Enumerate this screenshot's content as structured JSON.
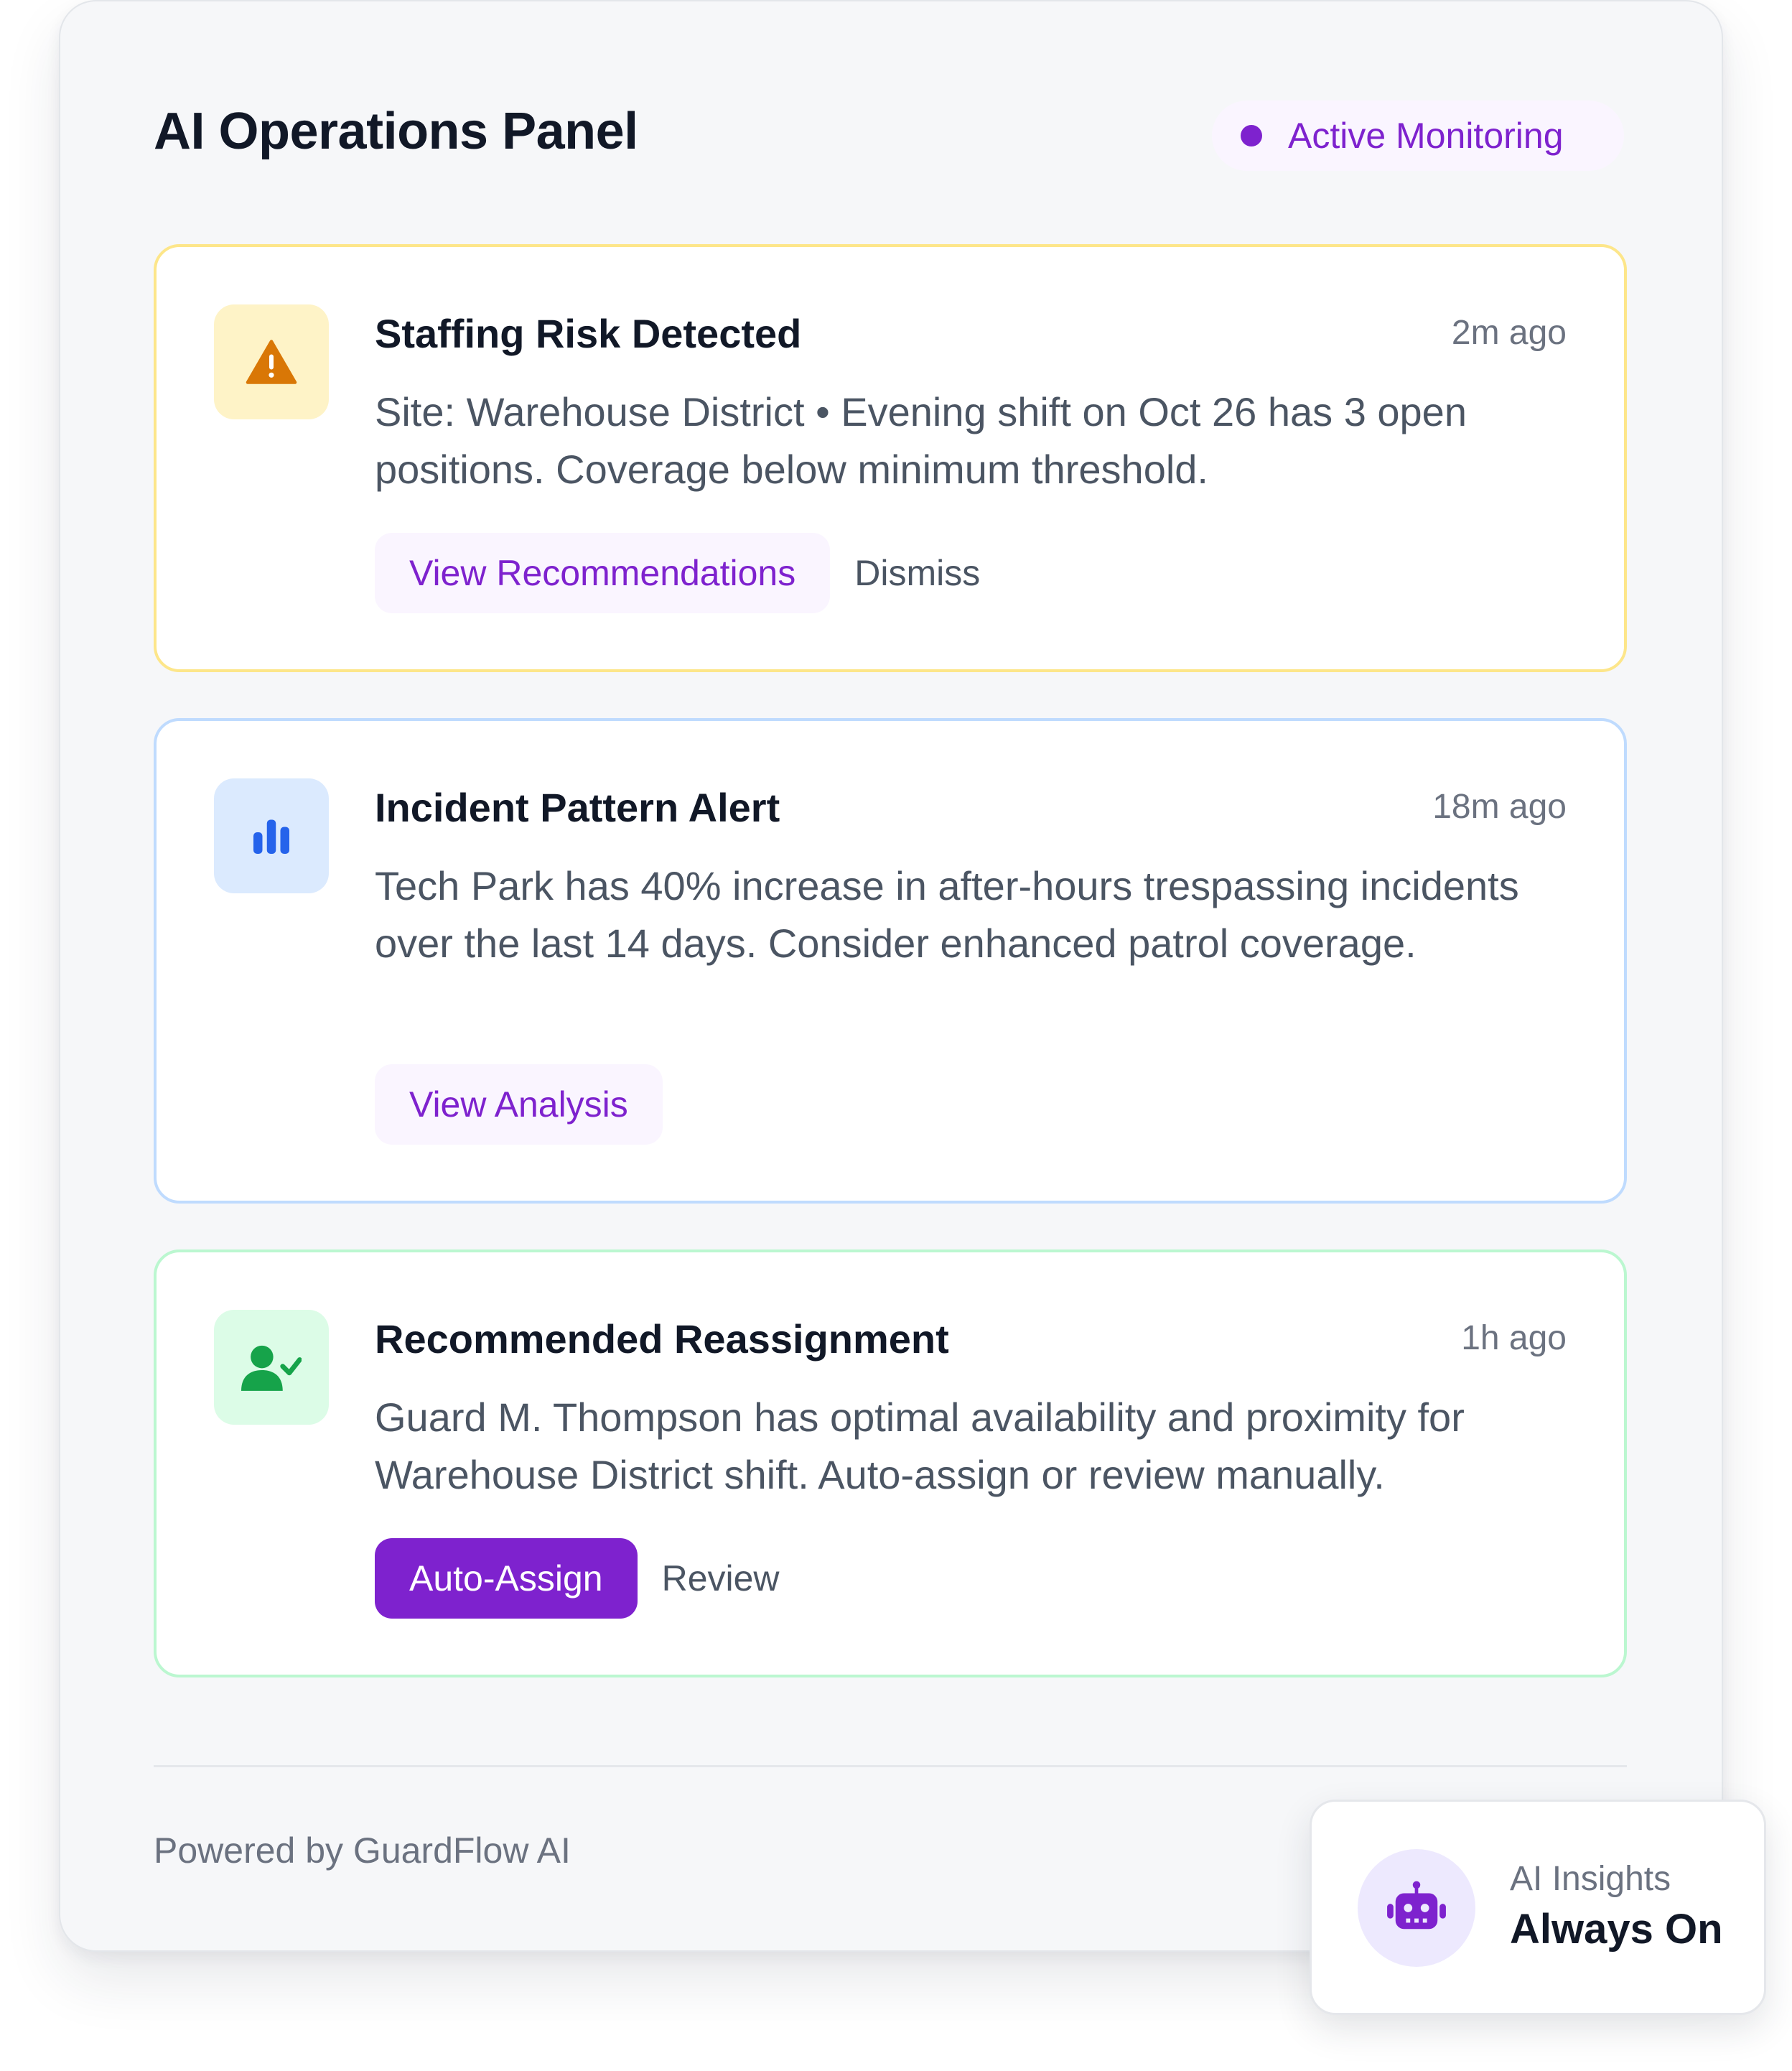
{
  "panel": {
    "title": "AI Operations Panel",
    "status_badge": "Active Monitoring"
  },
  "cards": [
    {
      "icon": "warning-triangle-icon",
      "title": "Staffing Risk Detected",
      "time": "2m ago",
      "body": "Site: Warehouse District • Evening shift on Oct 26 has 3 open positions. Coverage below minimum threshold.",
      "primary_action": "View Recommendations",
      "secondary_action": "Dismiss"
    },
    {
      "icon": "bar-chart-icon",
      "title": "Incident Pattern Alert",
      "time": "18m ago",
      "body": "Tech Park has 40% increase in after-hours trespassing incidents over the last 14 days. Consider enhanced patrol coverage.",
      "primary_action": "View Analysis"
    },
    {
      "icon": "user-check-icon",
      "title": "Recommended Reassignment",
      "time": "1h ago",
      "body": "Guard M. Thompson has optimal availability and proximity for Warehouse District shift. Auto-assign or review manually.",
      "primary_action": "Auto-Assign",
      "secondary_action": "Review"
    }
  ],
  "footer": {
    "powered_by": "Powered by GuardFlow AI"
  },
  "ai_widget": {
    "icon": "robot-icon",
    "label": "AI Insights",
    "status": "Always On"
  },
  "colors": {
    "accent": "#7e22ce",
    "warning_bg": "#fef3c7",
    "warning_icon": "#d97706",
    "info_bg": "#dbeafe",
    "info_icon": "#2563eb",
    "success_bg": "#dcfce7",
    "success_icon": "#16a34a"
  }
}
